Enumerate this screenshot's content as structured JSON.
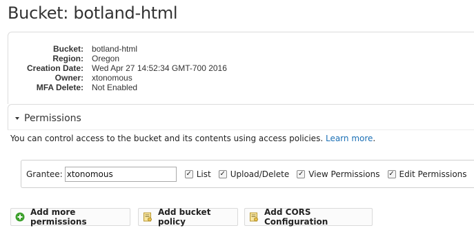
{
  "page": {
    "title": "Bucket: botland-html"
  },
  "properties": [
    {
      "key": "Bucket:",
      "value": "botland-html"
    },
    {
      "key": "Region:",
      "value": "Oregon"
    },
    {
      "key": "Creation Date:",
      "value": "Wed Apr 27 14:52:34 GMT-700 2016"
    },
    {
      "key": "Owner:",
      "value": "xtonomous"
    },
    {
      "key": "MFA Delete:",
      "value": "Not Enabled"
    }
  ],
  "permissions": {
    "title": "Permissions",
    "description": "You can control access to the bucket and its contents using access policies.",
    "learn_more": "Learn more",
    "period": ".",
    "grantee_label": "Grantee:",
    "grantee_value": "xtonomous",
    "checkboxes": [
      {
        "label": "List",
        "checked": true
      },
      {
        "label": "Upload/Delete",
        "checked": true
      },
      {
        "label": "View Permissions",
        "checked": true
      },
      {
        "label": "Edit Permissions",
        "checked": true
      }
    ]
  },
  "buttons": {
    "add_permissions": "Add more permissions",
    "add_policy": "Add bucket policy",
    "add_cors": "Add CORS Configuration"
  },
  "colors": {
    "link": "#1a6fb5",
    "add_icon": "#3ea12e",
    "policy_icon": "#e8c04a"
  },
  "icons": {
    "add_permissions": "plus-circle-icon",
    "add_policy": "policy-document-icon",
    "add_cors": "policy-document-icon",
    "section_toggle": "caret-down-icon"
  }
}
